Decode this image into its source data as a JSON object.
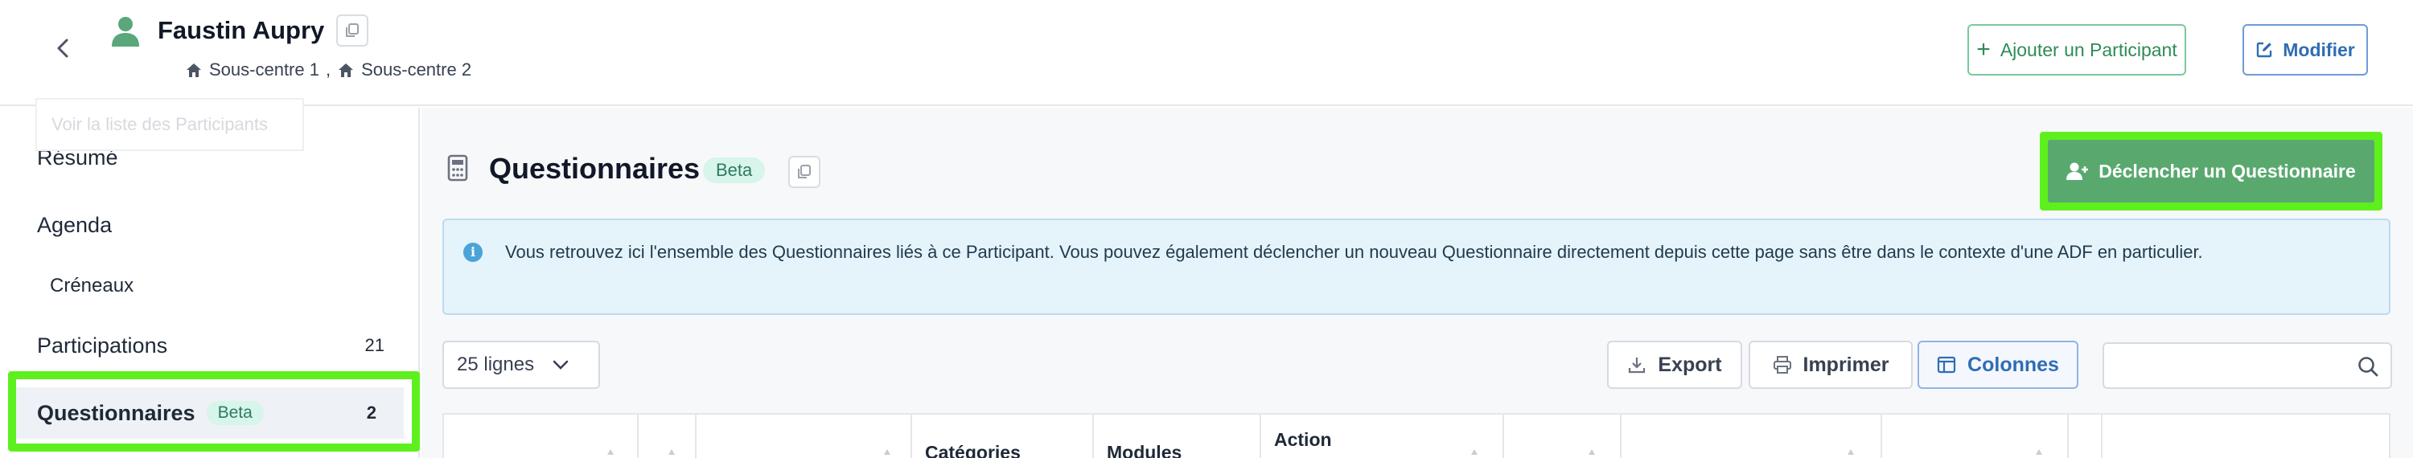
{
  "header": {
    "participant_name": "Faustin Aupry",
    "breadcrumb": [
      "Sous-centre 1",
      "Sous-centre 2"
    ],
    "breadcrumb_separator": ",",
    "add_participant_label": "Ajouter un Participant",
    "edit_label": "Modifier"
  },
  "sidebar": {
    "tooltip": "Voir la liste des Participants",
    "items": [
      {
        "label": "Résumé"
      },
      {
        "label": "Agenda"
      },
      {
        "label": "Créneaux"
      },
      {
        "label": "Participations",
        "count": "21"
      },
      {
        "label": "Questionnaires",
        "badge": "Beta",
        "count": "2"
      }
    ]
  },
  "main": {
    "title": "Questionnaires",
    "badge": "Beta",
    "trigger_label": "Déclencher un Questionnaire",
    "info_text": "Vous retrouvez ici l'ensemble des Questionnaires liés à ce Participant. Vous pouvez également déclencher un nouveau Questionnaire directement depuis cette page sans être dans le contexte d'une ADF en particulier.",
    "rows_select": "25 lignes",
    "export_label": "Export",
    "print_label": "Imprimer",
    "columns_label": "Colonnes",
    "search_placeholder": "",
    "table_headers": [
      "",
      "",
      "",
      "Catégories",
      "Modules",
      "Action",
      "",
      "",
      "",
      "",
      ""
    ]
  },
  "colors": {
    "accent_green": "#5ef01e",
    "primary_green": "#59a96f",
    "primary_blue": "#2f6db3",
    "info_bg": "#e5f3fb",
    "badge_bg": "#d7f5ea"
  },
  "icons": {
    "back": "chevron-left-icon",
    "avatar": "user-icon",
    "copy": "copy-icon",
    "home": "home-icon",
    "plus": "plus-icon",
    "edit": "edit-icon",
    "calculator": "calculator-icon",
    "user_plus": "user-plus-icon",
    "info": "info-icon",
    "download": "download-icon",
    "print": "printer-icon",
    "columns": "columns-icon",
    "search": "search-icon",
    "dropdown": "chevron-down-icon"
  }
}
